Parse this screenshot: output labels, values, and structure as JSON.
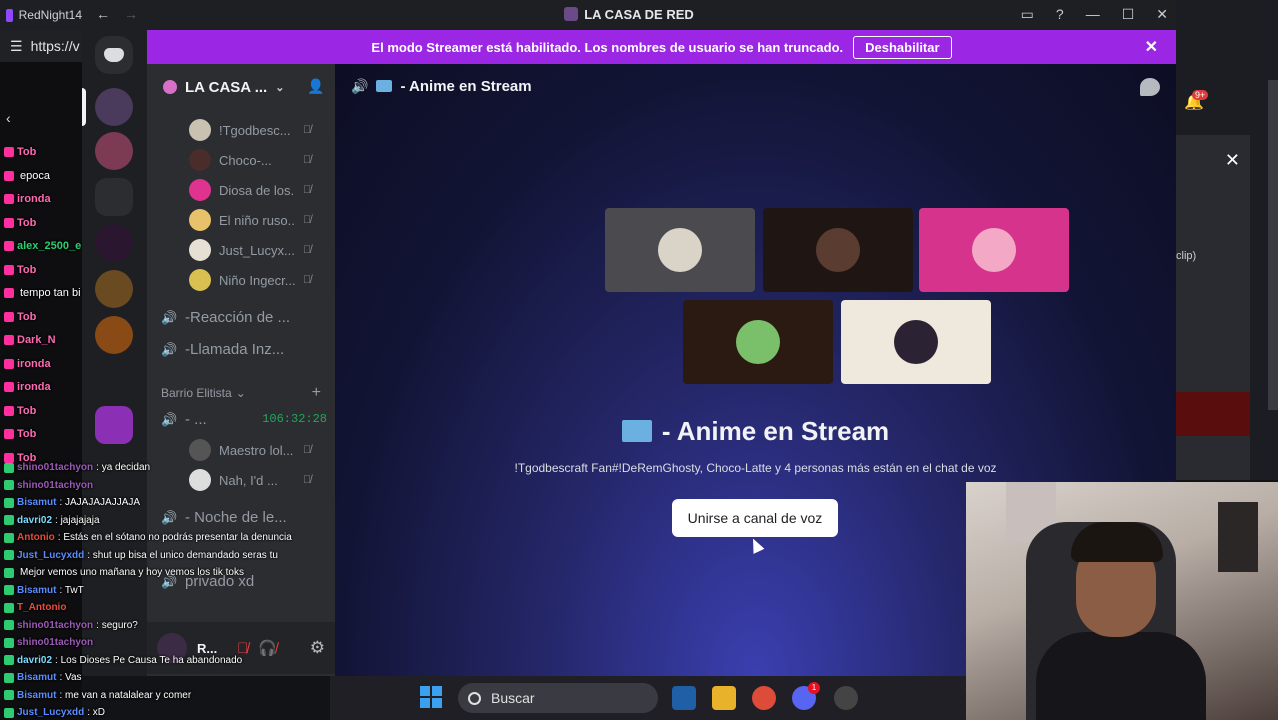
{
  "background_browser": {
    "tab_title": "RedNight14",
    "url_fragment": "https://v",
    "right_panel_text": "clip)",
    "notification_count": "9+"
  },
  "window": {
    "title": "LA CASA DE RED"
  },
  "banner": {
    "message": "El modo Streamer está habilitado. Los nombres de usuario se han truncado.",
    "button_label": "Deshabilitar",
    "color": "#9b27e5"
  },
  "server": {
    "name": "LA CASA ..."
  },
  "voice_users": [
    {
      "name": "!Tgodbesc...",
      "color": "#c9c1b2"
    },
    {
      "name": "Choco-...",
      "color": "#4a2c2a"
    },
    {
      "name": "Diosa de los...",
      "color": "#e0338f"
    },
    {
      "name": "El niño ruso...",
      "color": "#e8c26b"
    },
    {
      "name": "Just_Lucyx...",
      "color": "#e6e0d4"
    },
    {
      "name": "Niño Ingecr...",
      "color": "#d9c050"
    }
  ],
  "voice_channels": [
    {
      "name": "-Reacción de ..."
    },
    {
      "name": "-Llamada Inz..."
    }
  ],
  "category": {
    "name": "Barrio Elitista"
  },
  "elitista_users": [
    {
      "name": "- ...",
      "time": "106:32:28"
    },
    {
      "name": "Maestro lol..."
    },
    {
      "name": "Nah, I'd ..."
    }
  ],
  "more_channels": [
    {
      "name": "- Noche de le..."
    },
    {
      "name": "privado xd"
    }
  ],
  "user_panel": {
    "name": "R..."
  },
  "main": {
    "channel_title": "- Anime en Stream",
    "stage_title": "- Anime en Stream",
    "participants_text": "!Tgodbescraft Fan#!DeRemGhosty, Choco-Latte y 4 personas más están en el chat de voz",
    "join_button": "Unirse a canal de voz",
    "tiles": [
      {
        "bg": "#4b4b4f",
        "avatar": "#d9d3c8"
      },
      {
        "bg": "#1f1513",
        "avatar": "#5a3c30"
      },
      {
        "bg": "#d6338c",
        "avatar": "#f3a8c6"
      },
      {
        "bg": "#2a1a12",
        "avatar": "#7ac06a"
      },
      {
        "bg": "#efe8dc",
        "avatar": "#2b2233"
      }
    ]
  },
  "chat": [
    {
      "user": "Tob",
      "msg": "",
      "color": "#ff69b4"
    },
    {
      "user": "",
      "msg": "epoca",
      "color": "#ffffff"
    },
    {
      "user": "ironda",
      "msg": "",
      "color": "#ff69b4"
    },
    {
      "user": "Tob",
      "msg": "",
      "color": "#ff69b4"
    },
    {
      "user": "alex_2500_e",
      "msg": "",
      "color": "#2ecc71"
    },
    {
      "user": "Tob",
      "msg": "",
      "color": "#ff69b4"
    },
    {
      "user": "",
      "msg": "tempo tan bi",
      "color": "#ffffff"
    },
    {
      "user": "Tob",
      "msg": "",
      "color": "#ff69b4"
    },
    {
      "user": "Dark_N",
      "msg": "",
      "color": "#ff69b4"
    },
    {
      "user": "ironda",
      "msg": "",
      "color": "#ff69b4"
    },
    {
      "user": "ironda",
      "msg": "",
      "color": "#ff69b4"
    },
    {
      "user": "Tob",
      "msg": "",
      "color": "#ff69b4"
    },
    {
      "user": "Tob",
      "msg": "",
      "color": "#ff69b4"
    },
    {
      "user": "Tob",
      "msg": "",
      "color": "#ff69b4"
    },
    {
      "user": "shino01tachyon",
      "msg": ": ya decidan",
      "color": "#9b59b6"
    },
    {
      "user": "shino01tachyon",
      "msg": "",
      "color": "#9b59b6"
    },
    {
      "user": "Bisamut",
      "msg": ": JAJAJAJAJJAJA",
      "color": "#5b8cff"
    },
    {
      "user": "davri02",
      "msg": ": jajajajaja",
      "color": "#7fdbff"
    },
    {
      "user": "Antonio",
      "msg": ": Estás en el sótano no podrás presentar la denuncia",
      "color": "#e74c3c"
    },
    {
      "user": "Just_Lucyxdd",
      "msg": ": shut up bisa el unico demandado seras tu",
      "color": "#5b8cff"
    },
    {
      "user": "",
      "msg": "Mejor vemos uno mañana y hoy vemos los tik toks",
      "color": "#ffffff"
    },
    {
      "user": "Bisamut",
      "msg": ": TwT",
      "color": "#5b8cff"
    },
    {
      "user": "T_Antonio",
      "msg": "",
      "color": "#e74c3c"
    },
    {
      "user": "shino01tachyon",
      "msg": ": seguro?",
      "color": "#9b59b6"
    },
    {
      "user": "shino01tachyon",
      "msg": "",
      "color": "#9b59b6"
    },
    {
      "user": "davri02",
      "msg": ": Los Dioses Pe Causa Te ha abandonado",
      "color": "#7fdbff"
    },
    {
      "user": "Bisamut",
      "msg": ": Vas",
      "color": "#5b8cff"
    },
    {
      "user": "Bisamut",
      "msg": ": me van a natalalear y comer",
      "color": "#5b8cff"
    },
    {
      "user": "Just_Lucyxdd",
      "msg": ": xD",
      "color": "#5b8cff"
    }
  ],
  "taskbar": {
    "search_label": "Buscar",
    "discord_badge": "1"
  }
}
